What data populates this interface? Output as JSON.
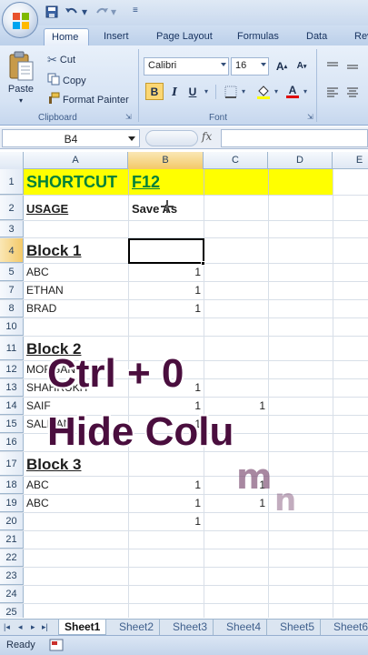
{
  "quick_access": {
    "save_icon": "save-icon",
    "undo_icon": "undo-icon",
    "redo_icon": "redo-icon"
  },
  "tabs": [
    "Home",
    "Insert",
    "Page Layout",
    "Formulas",
    "Data",
    "Rev"
  ],
  "ribbon": {
    "clipboard": {
      "paste": "Paste",
      "cut": "Cut",
      "copy": "Copy",
      "format_painter": "Format Painter",
      "label": "Clipboard"
    },
    "font": {
      "name": "Calibri",
      "size": "16",
      "label": "Font",
      "bold": "B",
      "italic": "I",
      "underline": "U"
    }
  },
  "formula_bar": {
    "name_box": "B4",
    "fx": "fx",
    "value": ""
  },
  "columns": [
    "A",
    "B",
    "C",
    "D",
    "E"
  ],
  "rows": [
    {
      "num": "1",
      "a": "SHORTCUT",
      "b": "F12",
      "c": "",
      "d": ""
    },
    {
      "num": "2",
      "a": "USAGE",
      "b": "Save As",
      "c": "",
      "d": ""
    },
    {
      "num": "3",
      "a": "",
      "b": "",
      "c": "",
      "d": ""
    },
    {
      "num": "4",
      "a": "Block 1",
      "b": "",
      "c": "",
      "d": ""
    },
    {
      "num": "5",
      "a": "ABC",
      "b": "1",
      "c": "",
      "d": ""
    },
    {
      "num": "7",
      "a": "ETHAN",
      "b": "1",
      "c": "",
      "d": ""
    },
    {
      "num": "8",
      "a": "BRAD",
      "b": "1",
      "c": "",
      "d": ""
    },
    {
      "num": "10",
      "a": "",
      "b": "",
      "c": "",
      "d": ""
    },
    {
      "num": "11",
      "a": "Block 2",
      "b": "",
      "c": "",
      "d": ""
    },
    {
      "num": "12",
      "a": "MORGAN",
      "b": "",
      "c": "",
      "d": ""
    },
    {
      "num": "13",
      "a": "SHAHRUKH",
      "b": "1",
      "c": "",
      "d": ""
    },
    {
      "num": "14",
      "a": "SAIF",
      "b": "1",
      "c": "1",
      "d": ""
    },
    {
      "num": "15",
      "a": "SALMAN",
      "b": "1",
      "c": "",
      "d": ""
    },
    {
      "num": "16",
      "a": "",
      "b": "",
      "c": "",
      "d": ""
    },
    {
      "num": "17",
      "a": "Block 3",
      "b": "",
      "c": "",
      "d": ""
    },
    {
      "num": "18",
      "a": "ABC",
      "b": "1",
      "c": "1",
      "d": ""
    },
    {
      "num": "19",
      "a": "ABC",
      "b": "1",
      "c": "1",
      "d": ""
    },
    {
      "num": "20",
      "a": "",
      "b": "1",
      "c": "",
      "d": ""
    },
    {
      "num": "21",
      "a": "",
      "b": "",
      "c": "",
      "d": ""
    },
    {
      "num": "22",
      "a": "",
      "b": "",
      "c": "",
      "d": ""
    },
    {
      "num": "23",
      "a": "",
      "b": "",
      "c": "",
      "d": ""
    },
    {
      "num": "24",
      "a": "",
      "b": "",
      "c": "",
      "d": ""
    },
    {
      "num": "25",
      "a": "",
      "b": "",
      "c": "",
      "d": ""
    }
  ],
  "sheets": [
    "Sheet1",
    "Sheet2",
    "Sheet3",
    "Sheet4",
    "Sheet5",
    "Sheet6"
  ],
  "status": {
    "mode": "Ready"
  },
  "overlay": {
    "line1": "Ctrl + 0",
    "line2": "Hide Colu",
    "watermark_m": "m",
    "watermark_n": "n"
  },
  "colors": {
    "header_yellow": "#ffff00",
    "selection_border": "#000000",
    "overlay_text": "#4a0e3e"
  }
}
